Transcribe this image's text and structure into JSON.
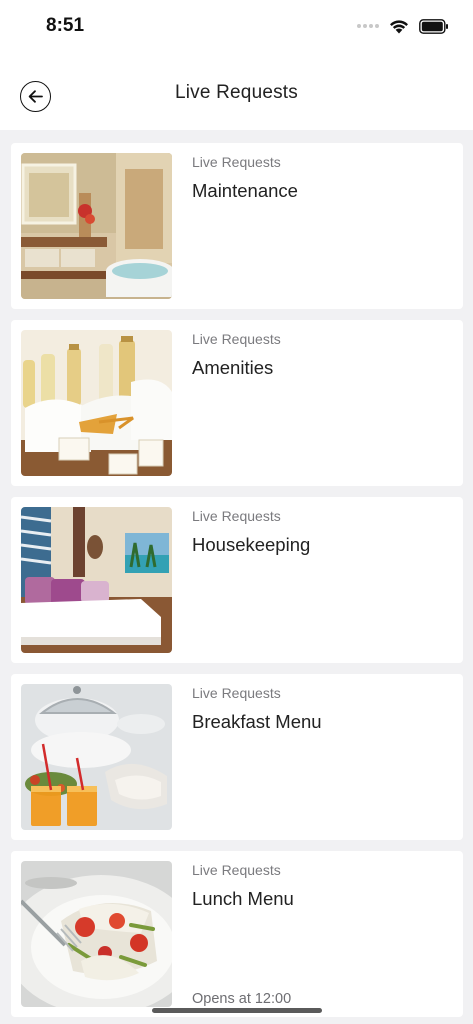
{
  "status_bar": {
    "time": "8:51",
    "icons": [
      "signal-dots-icon",
      "wifi-icon",
      "battery-icon"
    ]
  },
  "header": {
    "title": "Live Requests",
    "back_icon": "back-arrow-icon"
  },
  "items": [
    {
      "kicker": "Live Requests",
      "title": "Maintenance",
      "note": "",
      "image": "bathroom-photo"
    },
    {
      "kicker": "Live Requests",
      "title": "Amenities",
      "note": "",
      "image": "toiletries-photo"
    },
    {
      "kicker": "Live Requests",
      "title": "Housekeeping",
      "note": "",
      "image": "bedroom-photo"
    },
    {
      "kicker": "Live Requests",
      "title": "Breakfast Menu",
      "note": "",
      "image": "breakfast-photo"
    },
    {
      "kicker": "Live Requests",
      "title": "Lunch Menu",
      "note": "Opens at 12:00",
      "image": "salad-photo"
    }
  ],
  "colors": {
    "background": "#f1f1f3",
    "card": "#ffffff",
    "title_text": "#222222",
    "kicker_text": "#7a7a7e"
  }
}
